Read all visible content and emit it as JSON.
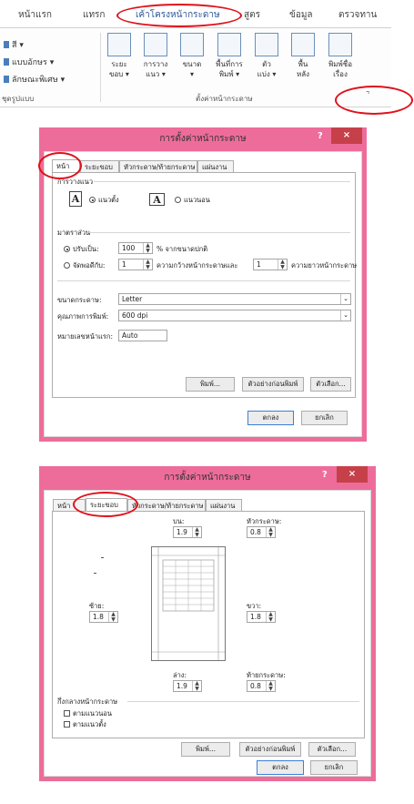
{
  "ribbon": {
    "tabs": [
      "หน้าแรก",
      "แทรก",
      "เค้าโครงหน้ากระดาษ",
      "สูตร",
      "ข้อมูล",
      "ตรวจทาน"
    ],
    "left_items": [
      "สี ▾",
      "แบบอักษร ▾",
      "ลักษณะพิเศษ ▾"
    ],
    "left_group_label": "ชุดรูปแบบ",
    "buttons": [
      {
        "l1": "ระยะ",
        "l2": "ขอบ ▾"
      },
      {
        "l1": "การวาง",
        "l2": "แนว ▾"
      },
      {
        "l1": "ขนาด",
        "l2": "▾"
      },
      {
        "l1": "พื้นที่การ",
        "l2": "พิมพ์ ▾"
      },
      {
        "l1": "ตัว",
        "l2": "แบ่ง ▾"
      },
      {
        "l1": "พื้น",
        "l2": "หลัง"
      },
      {
        "l1": "พิมพ์ชื่อ",
        "l2": "เรื่อง"
      }
    ],
    "group_label": "ตั้งค่าหน้ากระดาษ",
    "launcher_icon": "⌝"
  },
  "dialog1": {
    "title": "การตั้งค่าหน้ากระดาษ",
    "help": "?",
    "close": "×",
    "tabs": [
      "หน้า",
      "ระยะขอบ",
      "หัวกระดาษ/ท้ายกระดาษ",
      "แผ่นงาน"
    ],
    "orientation_label": "การวางแนว",
    "portrait": "แนวตั้ง",
    "landscape": "แนวนอน",
    "scaling_label": "มาตราส่วน",
    "adjust_to": "ปรับเป็น:",
    "adjust_value": "100",
    "adjust_suffix": "% จากขนาดปกติ",
    "fit_to": "จัดพอดีกับ:",
    "fit_wide": "1",
    "fit_wide_suffix": "ความกว้างหน้ากระดาษและ",
    "fit_tall": "1",
    "fit_tall_suffix": "ความยาวหน้ากระดาษ",
    "paper_size_label": "ขนาดกระดาษ:",
    "paper_size": "Letter",
    "print_quality_label": "คุณภาพการพิมพ์:",
    "print_quality": "600 dpi",
    "first_page_label": "หมายเลขหน้าแรก:",
    "first_page": "Auto",
    "print_btn": "พิมพ์...",
    "preview_btn": "ตัวอย่างก่อนพิมพ์",
    "options_btn": "ตัวเลือก...",
    "ok_btn": "ตกลง",
    "cancel_btn": "ยกเลิก"
  },
  "dialog2": {
    "title": "การตั้งค่าหน้ากระดาษ",
    "help": "?",
    "close": "×",
    "tabs": [
      "หน้า",
      "ระยะขอบ",
      "หัวกระดาษ/ท้ายกระดาษ",
      "แผ่นงาน"
    ],
    "top_label": "บน:",
    "top": "1.9",
    "header_label": "หัวกระดาษ:",
    "header": "0.8",
    "left_label": "ซ้าย:",
    "left": "1.8",
    "right_label": "ขวา:",
    "right": "1.8",
    "bottom_label": "ล่าง:",
    "bottom": "1.9",
    "footer_label": "ท้ายกระดาษ:",
    "footer": "0.8",
    "center_label": "กึ่งกลางหน้ากระดาษ",
    "horizontally": "ตามแนวนอน",
    "vertically": "ตามแนวตั้ง",
    "print_btn": "พิมพ์...",
    "preview_btn": "ตัวอย่างก่อนพิมพ์",
    "options_btn": "ตัวเลือก...",
    "ok_btn": "ตกลง",
    "cancel_btn": "ยกเลิก"
  }
}
